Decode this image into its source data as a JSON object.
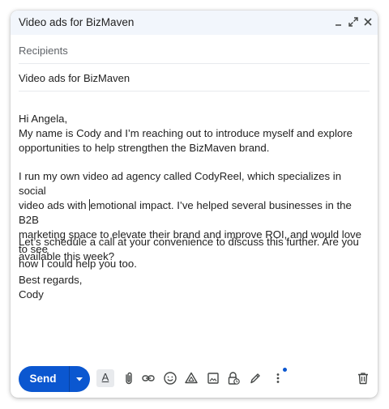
{
  "window": {
    "title": "Video ads for BizMaven"
  },
  "recipients": {
    "placeholder": "Recipients"
  },
  "subject": {
    "value": "Video ads for BizMaven"
  },
  "message": {
    "greeting": "Hi Angela,",
    "intro_line1": "My name is Cody and I’m reaching out to introduce myself and explore",
    "intro_line2": "opportunities to help strengthen the BizMaven brand.",
    "p2_line1": "I run my own video ad agency called CodyReel, which specializes in social",
    "p2_line2a": "video ads with ",
    "p2_line2b": "emotional impact. I’ve helped several businesses in the B2B",
    "p2_line3": "marketing space to elevate their brand and improve ROI, and would love to see",
    "p2_line4": "how I could help you too.",
    "p3_line1": "Let’s schedule a call at your convenience to discuss this further. Are you",
    "p3_line2": "available this week?",
    "closing": "Best regards,",
    "signature": "Cody"
  },
  "toolbar": {
    "send_label": "Send",
    "format_label": "A"
  },
  "colors": {
    "accent": "#0b57d0",
    "titlebar": "#f2f6fc",
    "text": "#1f1f1f",
    "muted": "#5f6368",
    "icon": "#444746"
  }
}
